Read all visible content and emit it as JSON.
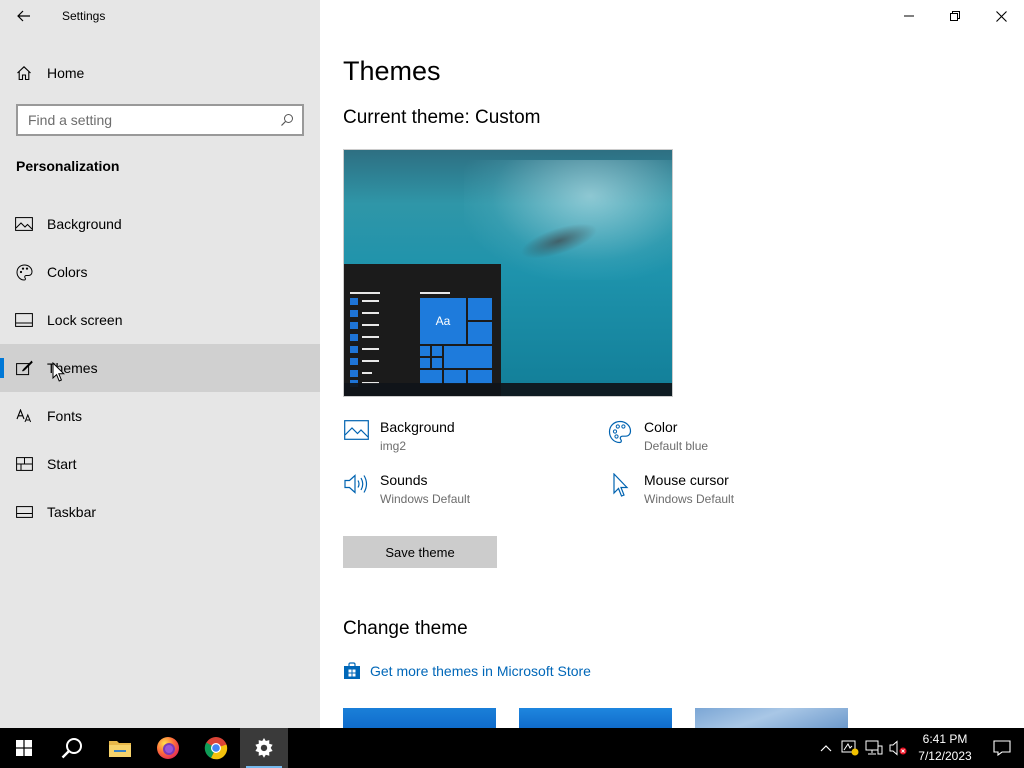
{
  "window": {
    "app_title": "Settings",
    "icons": {
      "back": "back-arrow-icon",
      "minimize": "minimize-icon",
      "maximize": "restore-icon",
      "close": "close-icon"
    }
  },
  "sidebar": {
    "home_label": "Home",
    "search_placeholder": "Find a setting",
    "section_title": "Personalization",
    "items": [
      {
        "label": "Background",
        "icon": "picture-icon"
      },
      {
        "label": "Colors",
        "icon": "palette-icon"
      },
      {
        "label": "Lock screen",
        "icon": "lock-screen-icon"
      },
      {
        "label": "Themes",
        "icon": "brush-icon",
        "active": true
      },
      {
        "label": "Fonts",
        "icon": "font-icon"
      },
      {
        "label": "Start",
        "icon": "start-layout-icon"
      },
      {
        "label": "Taskbar",
        "icon": "taskbar-icon"
      }
    ]
  },
  "main": {
    "title": "Themes",
    "current_theme": "Current theme: Custom",
    "preview_tile": "Aa",
    "properties": [
      {
        "label": "Background",
        "value": "img2",
        "icon": "picture-icon"
      },
      {
        "label": "Color",
        "value": "Default blue",
        "icon": "palette-icon"
      },
      {
        "label": "Sounds",
        "value": "Windows Default",
        "icon": "speaker-icon"
      },
      {
        "label": "Mouse cursor",
        "value": "Windows Default",
        "icon": "cursor-icon"
      }
    ],
    "save_button": "Save theme",
    "change_theme_title": "Change theme",
    "store_link": "Get more themes in Microsoft Store"
  },
  "taskbar": {
    "apps": [
      {
        "name": "start",
        "icon": "windows-logo-icon"
      },
      {
        "name": "search",
        "icon": "search-icon"
      },
      {
        "name": "file-explorer",
        "icon": "folder-icon"
      },
      {
        "name": "firefox",
        "icon": "firefox-icon"
      },
      {
        "name": "chrome",
        "icon": "chrome-icon"
      },
      {
        "name": "settings",
        "icon": "gear-icon",
        "active": true
      }
    ],
    "time": "6:41 PM",
    "date": "7/12/2023"
  },
  "colors": {
    "accent": "#0078d7",
    "link": "#0067b8",
    "sidebar_bg": "#e6e6e6",
    "taskbar_bg": "#000000"
  }
}
